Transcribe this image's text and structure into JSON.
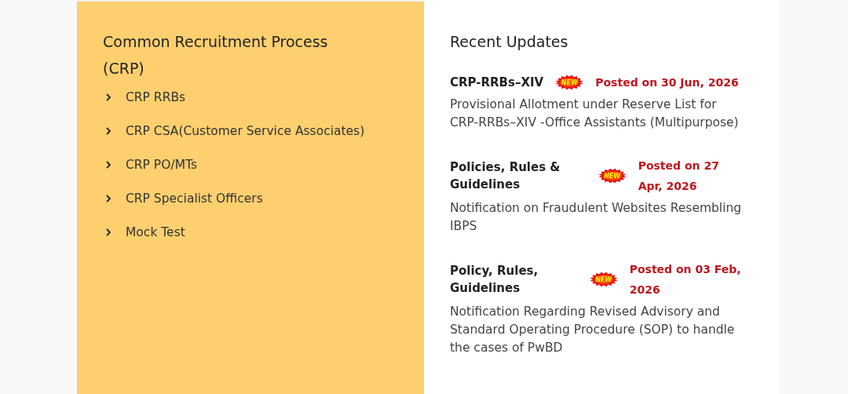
{
  "crp_panel": {
    "title": "Common Recruitment Process (CRP)",
    "links": [
      {
        "label": "CRP RRBs"
      },
      {
        "label": "CRP CSA(Customer Service Associates)"
      },
      {
        "label": "CRP PO/MTs"
      },
      {
        "label": "CRP Specialist Officers"
      },
      {
        "label": "Mock Test"
      }
    ]
  },
  "updates_panel": {
    "title": "Recent Updates",
    "items": [
      {
        "title": "CRP-RRBs–XIV",
        "badge": "NEW",
        "date": "Posted on 30 Jun, 2026",
        "text": "Provisional Allotment under Reserve List for CRP-RRBs–XIV -Office Assistants (Multipurpose)"
      },
      {
        "title": "Policies, Rules & Guidelines",
        "badge": "NEW",
        "date": "Posted on 27 Apr, 2026",
        "text": "Notification on Fraudulent Websites Resembling IBPS"
      },
      {
        "title": "Policy, Rules, Guidelines",
        "badge": "NEW",
        "date": "Posted on 03 Feb, 2026",
        "text": "Notification Regarding Revised Advisory and Standard Operating Procedure (SOP) to handle the cases of PwBD"
      }
    ]
  }
}
